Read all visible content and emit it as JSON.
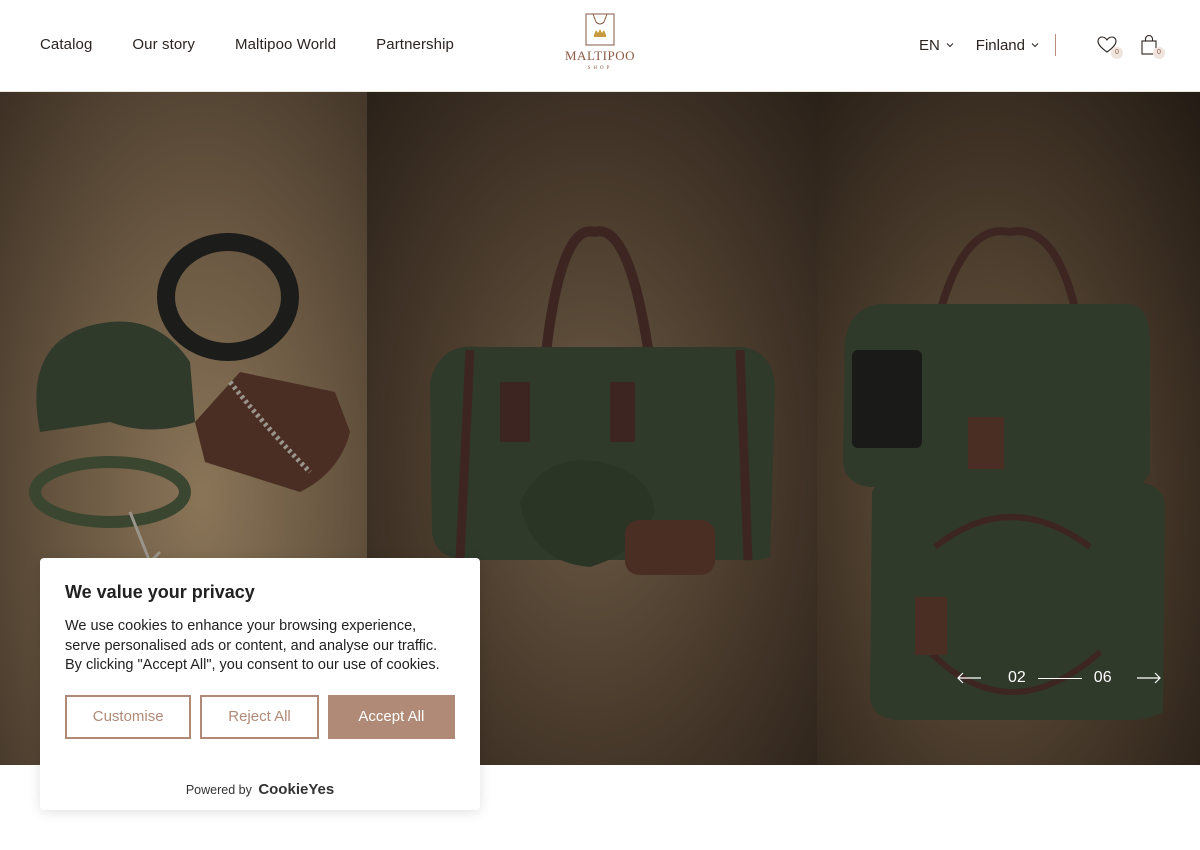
{
  "nav": [
    "Catalog",
    "Our story",
    "Maltipoo World",
    "Partnership"
  ],
  "logo": {
    "brand": "MALTIPOO",
    "sub": "SHOP"
  },
  "language": "EN",
  "country": "Finland",
  "wishlist_count": "0",
  "cart_count": "0",
  "slider": {
    "current": "02",
    "total": "06"
  },
  "cookie": {
    "title": "We value your privacy",
    "body": "We use cookies to enhance your browsing experience, serve personalised ads or content, and analyse our traffic. By clicking \"Accept All\", you consent to our use of cookies.",
    "customise": "Customise",
    "reject": "Reject All",
    "accept": "Accept All",
    "powered_by": "Powered by",
    "powered_brand": "CookieYes"
  },
  "colors": {
    "accent": "#b08a77",
    "logo": "#8a5a44"
  }
}
